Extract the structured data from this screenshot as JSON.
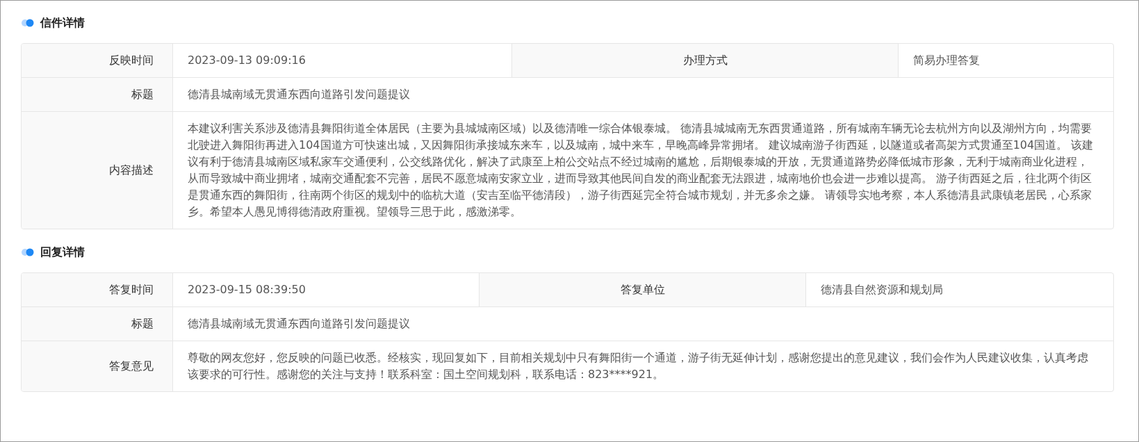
{
  "sections": [
    {
      "title": "信件详情",
      "rows": [
        {
          "cells": [
            {
              "label": "反映时间",
              "value": "2023-09-13 09:09:16"
            },
            {
              "label": "办理方式",
              "value": "简易办理答复"
            }
          ]
        },
        {
          "cells": [
            {
              "label": "标题",
              "value": "德清县城南域无贯通东西向道路引发问题提议"
            }
          ]
        },
        {
          "cells": [
            {
              "label": "内容描述",
              "value": "本建议利害关系涉及德清县舞阳街道全体居民（主要为县城城南区域）以及德清唯一综合体银泰城。 德清县城城南无东西贯通道路，所有城南车辆无论去杭州方向以及湖州方向，均需要北驶进入舞阳街再进入104国道方可快速出城，又因舞阳街承接城东来车，以及城南，城中来车，早晚高峰异常拥堵。 建议城南游子街西延，以隧道或者高架方式贯通至104国道。 该建议有利于德清县城南区域私家车交通便利，公交线路优化，解决了武康至上柏公交站点不经过城南的尴尬，后期银泰城的开放，无贯通道路势必降低城市形象，无利于城南商业化进程，从而导致城中商业拥堵，城南交通配套不完善，居民不愿意城南安家立业，进而导致其他民间自发的商业配套无法跟进，城南地价也会进一步难以提高。 游子街西延之后，往北两个街区是贯通东西的舞阳街，往南两个街区的规划中的临杭大道（安吉至临平德清段），游子街西延完全符合城市规划，并无多余之嫌。 请领导实地考察，本人系德清县武康镇老居民，心系家乡。希望本人愚见博得德清政府重视。望领导三思于此，感激涕零。"
            }
          ]
        }
      ]
    },
    {
      "title": "回复详情",
      "rows": [
        {
          "cells": [
            {
              "label": "答复时间",
              "value": "2023-09-15 08:39:50"
            },
            {
              "label": "答复单位",
              "value": "德清县自然资源和规划局"
            }
          ]
        },
        {
          "cells": [
            {
              "label": "标题",
              "value": "德清县城南域无贯通东西向道路引发问题提议"
            }
          ]
        },
        {
          "cells": [
            {
              "label": "答复意见",
              "value": "尊敬的网友您好，您反映的问题已收悉。经核实，现回复如下，目前相关规划中只有舞阳街一个通道，游子街无延伸计划，感谢您提出的意见建议，我们会作为人民建议收集，认真考虑该要求的可行性。感谢您的关注与支持！联系科室：国土空间规划科，联系电话：823****921。"
            }
          ]
        }
      ]
    }
  ]
}
